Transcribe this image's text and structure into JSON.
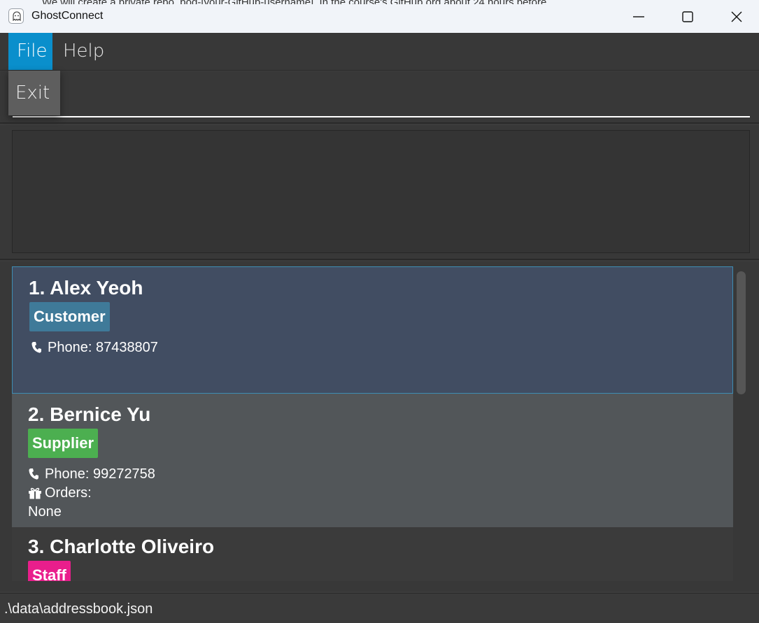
{
  "window": {
    "title": "GhostConnect",
    "background_text": "We will create a private repo, pod-[your-GitHub-username]. In the course's GitHub org about 24 hours before"
  },
  "menu": {
    "items": [
      {
        "label": "File",
        "active": true
      },
      {
        "label": "Help",
        "active": false
      }
    ],
    "file_dropdown": [
      {
        "label": "Exit"
      }
    ]
  },
  "command_box": {
    "value": "",
    "placeholder": ""
  },
  "result_display": {
    "text": ""
  },
  "persons": [
    {
      "index_name": "1. Alex Yeoh",
      "tag": {
        "label": "Customer",
        "color": "#3f7a99"
      },
      "phone_label": "Phone: 87438807",
      "selected": true
    },
    {
      "index_name": "2. Bernice Yu",
      "tag": {
        "label": "Supplier",
        "color": "#4caf50"
      },
      "phone_label": "Phone: 99272758",
      "orders_label": "Orders:",
      "orders_value": "None",
      "selected": false
    },
    {
      "index_name": "3. Charlotte Oliveiro",
      "tag": {
        "label": "Staff",
        "color": "#e91e8c"
      },
      "selected": false
    }
  ],
  "icons": {
    "app": "ghost-icon",
    "phone": "phone-icon",
    "orders": "gift-icon",
    "minimize": "minimize-icon",
    "maximize": "maximize-icon",
    "close": "close-icon"
  },
  "status_bar": {
    "path": ".\\data\\addressbook.json"
  }
}
